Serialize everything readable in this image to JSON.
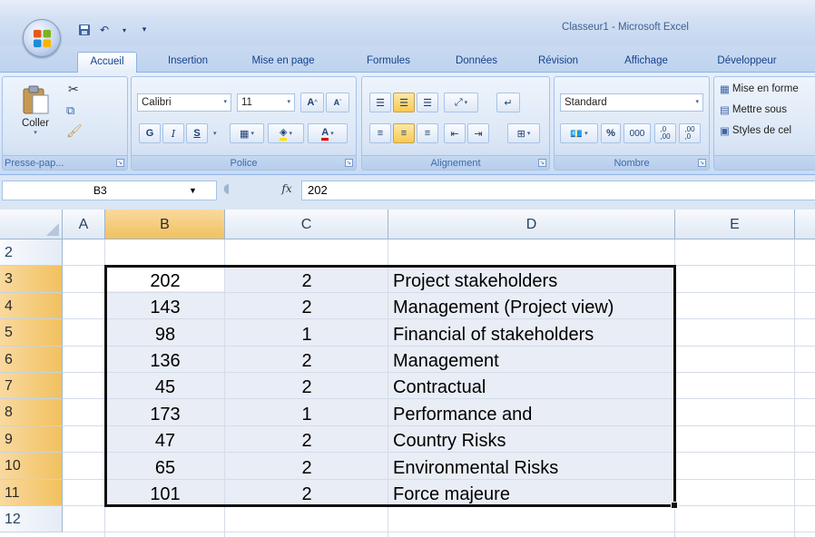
{
  "window": {
    "title": "Classeur1 - Microsoft Excel"
  },
  "ribbon": {
    "tabs": [
      "Accueil",
      "Insertion",
      "Mise en page",
      "Formules",
      "Données",
      "Révision",
      "Affichage",
      "Développeur"
    ],
    "active_tab": "Accueil",
    "clipboard": {
      "paste_label": "Coller",
      "group_label": "Presse-pap..."
    },
    "font": {
      "name": "Calibri",
      "size": "11",
      "bold": "G",
      "italic": "I",
      "underline": "S",
      "group_label": "Police"
    },
    "alignment": {
      "group_label": "Alignement"
    },
    "number": {
      "format": "Standard",
      "percent": "%",
      "thousands": "000",
      "inc_decimal": ",0\n,00",
      "dec_decimal": ",00\n,0",
      "group_label": "Nombre"
    },
    "styles": {
      "conditional": "Mise en forme",
      "as_table": "Mettre sous",
      "cell_styles": "Styles de cel"
    }
  },
  "formula_bar": {
    "name_box": "B3",
    "fx": "fx",
    "value": "202"
  },
  "sheet": {
    "columns": [
      "A",
      "B",
      "C",
      "D",
      "E"
    ],
    "selected_column": "B",
    "rows": [
      {
        "num": "2",
        "b": "",
        "c": "",
        "d": ""
      },
      {
        "num": "3",
        "b": "202",
        "c": "2",
        "d": "Project stakeholders"
      },
      {
        "num": "4",
        "b": "143",
        "c": "2",
        "d": "Management (Project view)"
      },
      {
        "num": "5",
        "b": "98",
        "c": "1",
        "d": "Financial of stakeholders"
      },
      {
        "num": "6",
        "b": "136",
        "c": "2",
        "d": "Management"
      },
      {
        "num": "7",
        "b": "45",
        "c": "2",
        "d": "Contractual"
      },
      {
        "num": "8",
        "b": "173",
        "c": "1",
        "d": "Performance and"
      },
      {
        "num": "9",
        "b": "47",
        "c": "2",
        "d": "Country Risks"
      },
      {
        "num": "10",
        "b": "65",
        "c": "2",
        "d": "Environmental Risks"
      },
      {
        "num": "11",
        "b": "101",
        "c": "2",
        "d": "Force majeure"
      },
      {
        "num": "12",
        "b": "",
        "c": "",
        "d": ""
      }
    ]
  }
}
